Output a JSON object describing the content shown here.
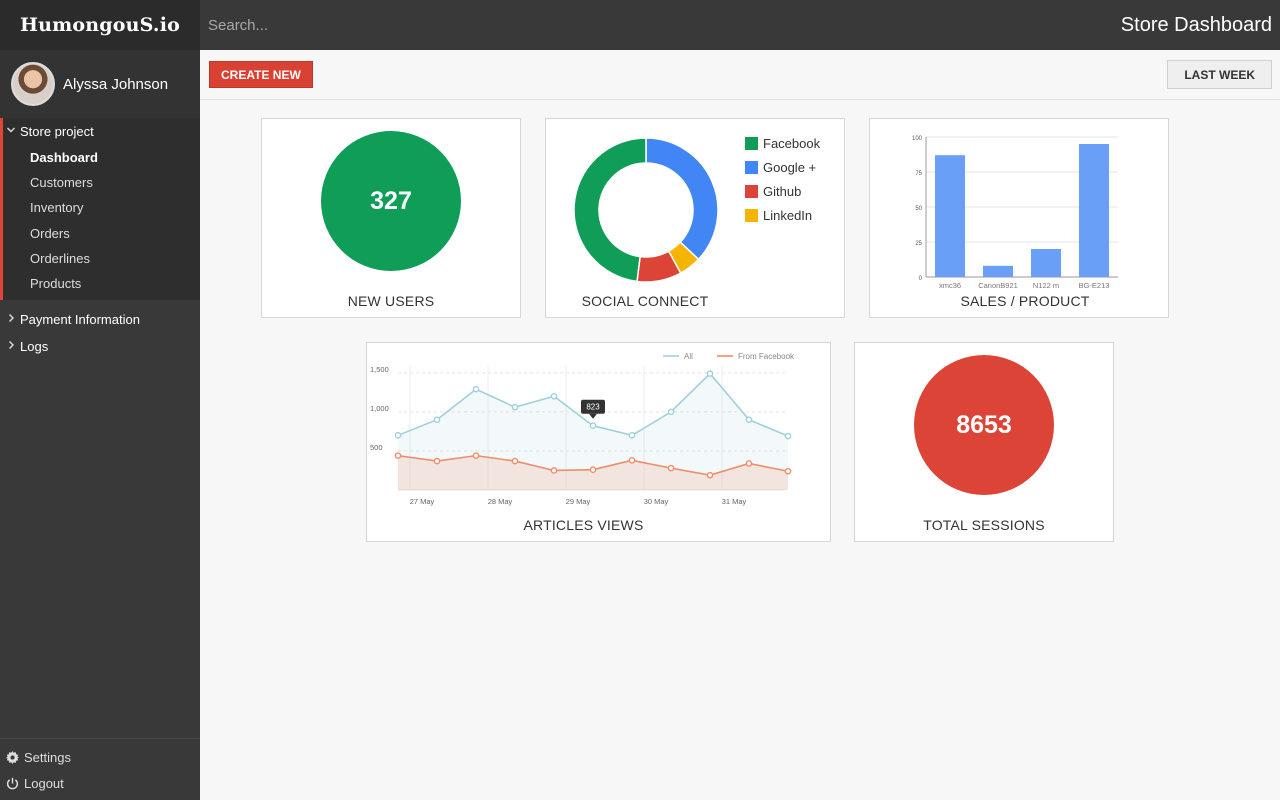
{
  "brand": "HumongouS.io",
  "user": {
    "name": "Alyssa Johnson"
  },
  "search": {
    "placeholder": "Search..."
  },
  "header": {
    "title": "Store Dashboard"
  },
  "toolbar": {
    "create_label": "CREATE NEW",
    "range_label": "LAST WEEK"
  },
  "nav": {
    "project": {
      "label": "Store project",
      "items": [
        "Dashboard",
        "Customers",
        "Inventory",
        "Orders",
        "Orderlines",
        "Products"
      ]
    },
    "payment_label": "Payment Information",
    "logs_label": "Logs"
  },
  "bottom": {
    "settings_label": "Settings",
    "logout_label": "Logout"
  },
  "cards": {
    "new_users": {
      "title": "NEW USERS",
      "value": "327",
      "color": "#0f9d58"
    },
    "social": {
      "title": "SOCIAL CONNECT"
    },
    "sales": {
      "title": "SALES / PRODUCT"
    },
    "articles": {
      "title": "ARTICLES VIEWS"
    },
    "sessions": {
      "title": "TOTAL SESSIONS",
      "value": "8653",
      "color": "#db4437"
    }
  },
  "chart_data": [
    {
      "type": "pie",
      "labels": [
        "Facebook",
        "Google +",
        "Github",
        "LinkedIn"
      ],
      "values": [
        48,
        37,
        10,
        5
      ],
      "colors": [
        "#0f9d58",
        "#4285f4",
        "#db4437",
        "#f4b400"
      ],
      "legend": "right"
    },
    {
      "type": "bar",
      "categories": [
        "xmc36",
        "CanonB921",
        "N122 m",
        "BG-E213"
      ],
      "values": [
        87,
        8,
        20,
        95
      ],
      "ylim": [
        0,
        100
      ],
      "yticks": [
        "0",
        "25",
        "50",
        "75",
        "100"
      ],
      "color": "#6a9ff7",
      "grid": true
    },
    {
      "type": "line",
      "xticks": [
        "27 May",
        "28 May",
        "29 May",
        "30 May",
        "31 May"
      ],
      "ytick_labels": [
        "500",
        "1,000",
        "1,500"
      ],
      "yticks": [
        500,
        1000,
        1500
      ],
      "ylim": [
        0,
        1600
      ],
      "series": [
        {
          "name": "All",
          "color": "#9fd0dc",
          "values": [
            700,
            900,
            1290,
            1060,
            1200,
            823,
            700,
            1000,
            1490,
            900,
            690
          ]
        },
        {
          "name": "From Facebook",
          "color": "#ef8c6a",
          "values": [
            440,
            370,
            440,
            370,
            250,
            260,
            380,
            280,
            190,
            340,
            240
          ]
        }
      ],
      "tooltip": {
        "label": "823",
        "index": 5
      },
      "legend": "top-right"
    }
  ]
}
